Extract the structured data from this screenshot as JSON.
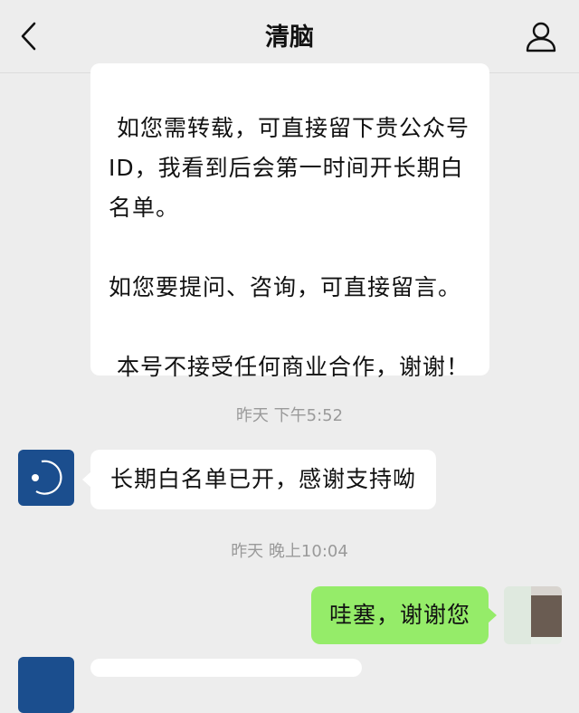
{
  "header": {
    "title": "清脑",
    "back_icon": "chevron-left-icon",
    "profile_icon": "person-icon"
  },
  "messages": {
    "long_notice": {
      "para1": " 如您需转载，可直接留下贵公众号ID，我看到后会第一时间开长期白名单。",
      "para2": "如您要提问、咨询，可直接留言。",
      "para3": " 本号不接受任何商业合作，谢谢！"
    },
    "timestamp1": "昨天 下午5:52",
    "reply1": "长期白名单已开，感谢支持呦",
    "timestamp2": "昨天 晚上10:04",
    "my_reply": "哇塞，谢谢您"
  },
  "colors": {
    "background": "#ededed",
    "bubble_other": "#ffffff",
    "bubble_me": "#95ec69",
    "avatar_brand": "#1b4e8e"
  }
}
